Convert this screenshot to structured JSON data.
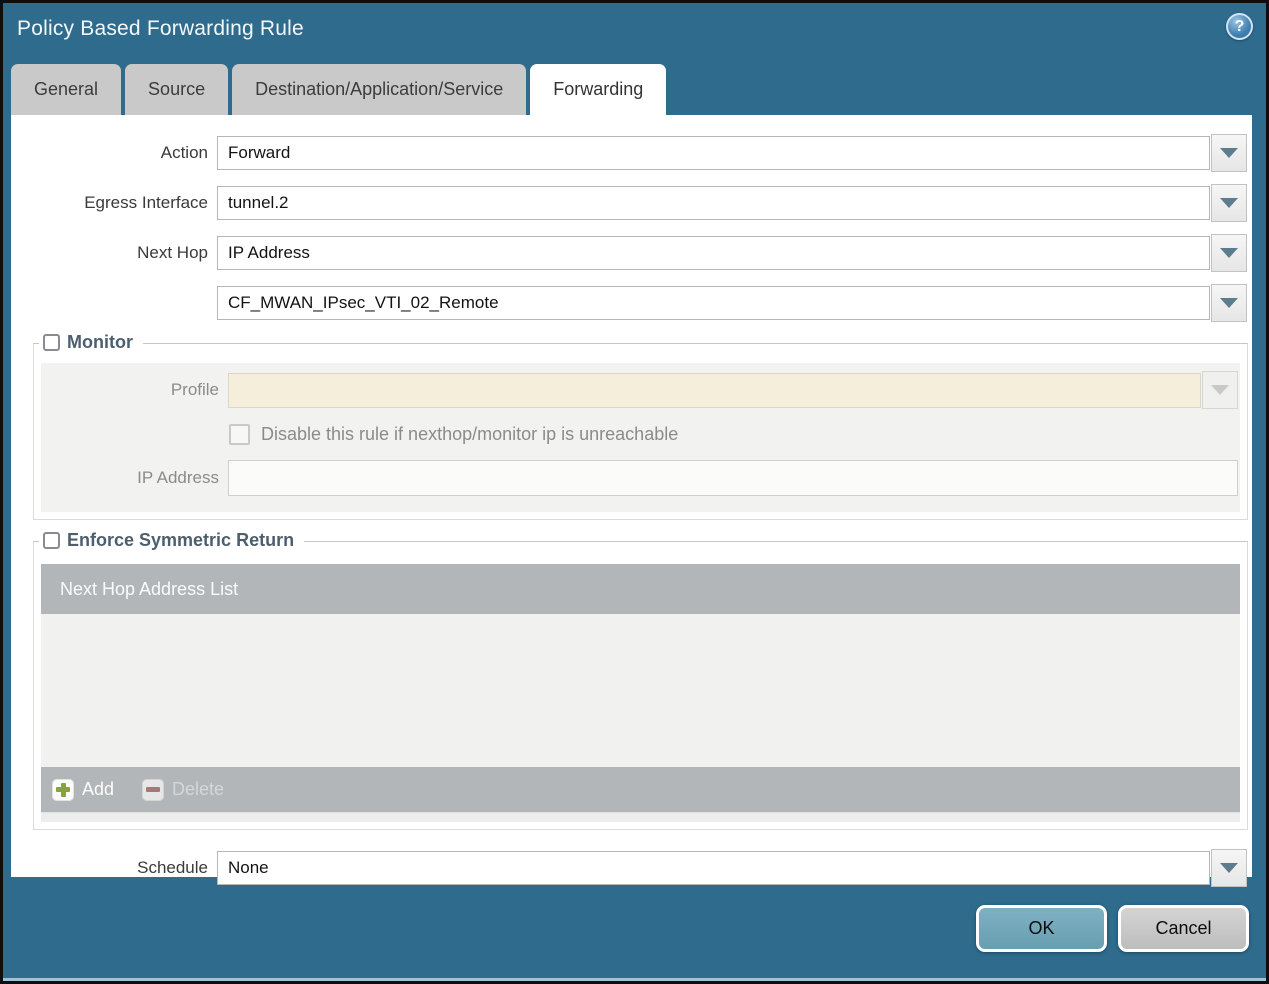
{
  "window": {
    "title": "Policy Based Forwarding Rule",
    "help_icon": "?"
  },
  "tabs": [
    {
      "label": "General",
      "active": false
    },
    {
      "label": "Source",
      "active": false
    },
    {
      "label": "Destination/Application/Service",
      "active": false
    },
    {
      "label": "Forwarding",
      "active": true
    }
  ],
  "form": {
    "action": {
      "label": "Action",
      "value": "Forward"
    },
    "egress_interface": {
      "label": "Egress Interface",
      "value": "tunnel.2"
    },
    "next_hop": {
      "label": "Next Hop",
      "value": "IP Address"
    },
    "next_hop_address": {
      "label": "",
      "value": "CF_MWAN_IPsec_VTI_02_Remote"
    },
    "schedule": {
      "label": "Schedule",
      "value": "None"
    }
  },
  "monitor": {
    "legend": "Monitor",
    "checked": false,
    "profile": {
      "label": "Profile",
      "value": ""
    },
    "disable_rule": {
      "label": "Disable this rule if nexthop/monitor ip is unreachable",
      "checked": false
    },
    "ip_address": {
      "label": "IP Address",
      "value": ""
    }
  },
  "symmetric_return": {
    "legend": "Enforce Symmetric Return",
    "checked": false,
    "table": {
      "header": "Next Hop Address List",
      "rows": []
    },
    "toolbar": {
      "add_label": "Add",
      "delete_label": "Delete",
      "delete_enabled": false
    }
  },
  "footer": {
    "ok_label": "OK",
    "cancel_label": "Cancel"
  },
  "colors": {
    "titlebar": "#2e6b8d",
    "tab_inactive": "#c9c9c9",
    "tab_active": "#ffffff",
    "section_label": "#4c5f6e",
    "table_header_bg": "#b3b6b8",
    "disabled_field_bg": "#f5eedb",
    "ok_button_bg": "#72a7b9",
    "cancel_button_bg": "#c8c8c8",
    "add_icon_green": "#87a33c",
    "delete_icon_red": "#a15f5f"
  }
}
